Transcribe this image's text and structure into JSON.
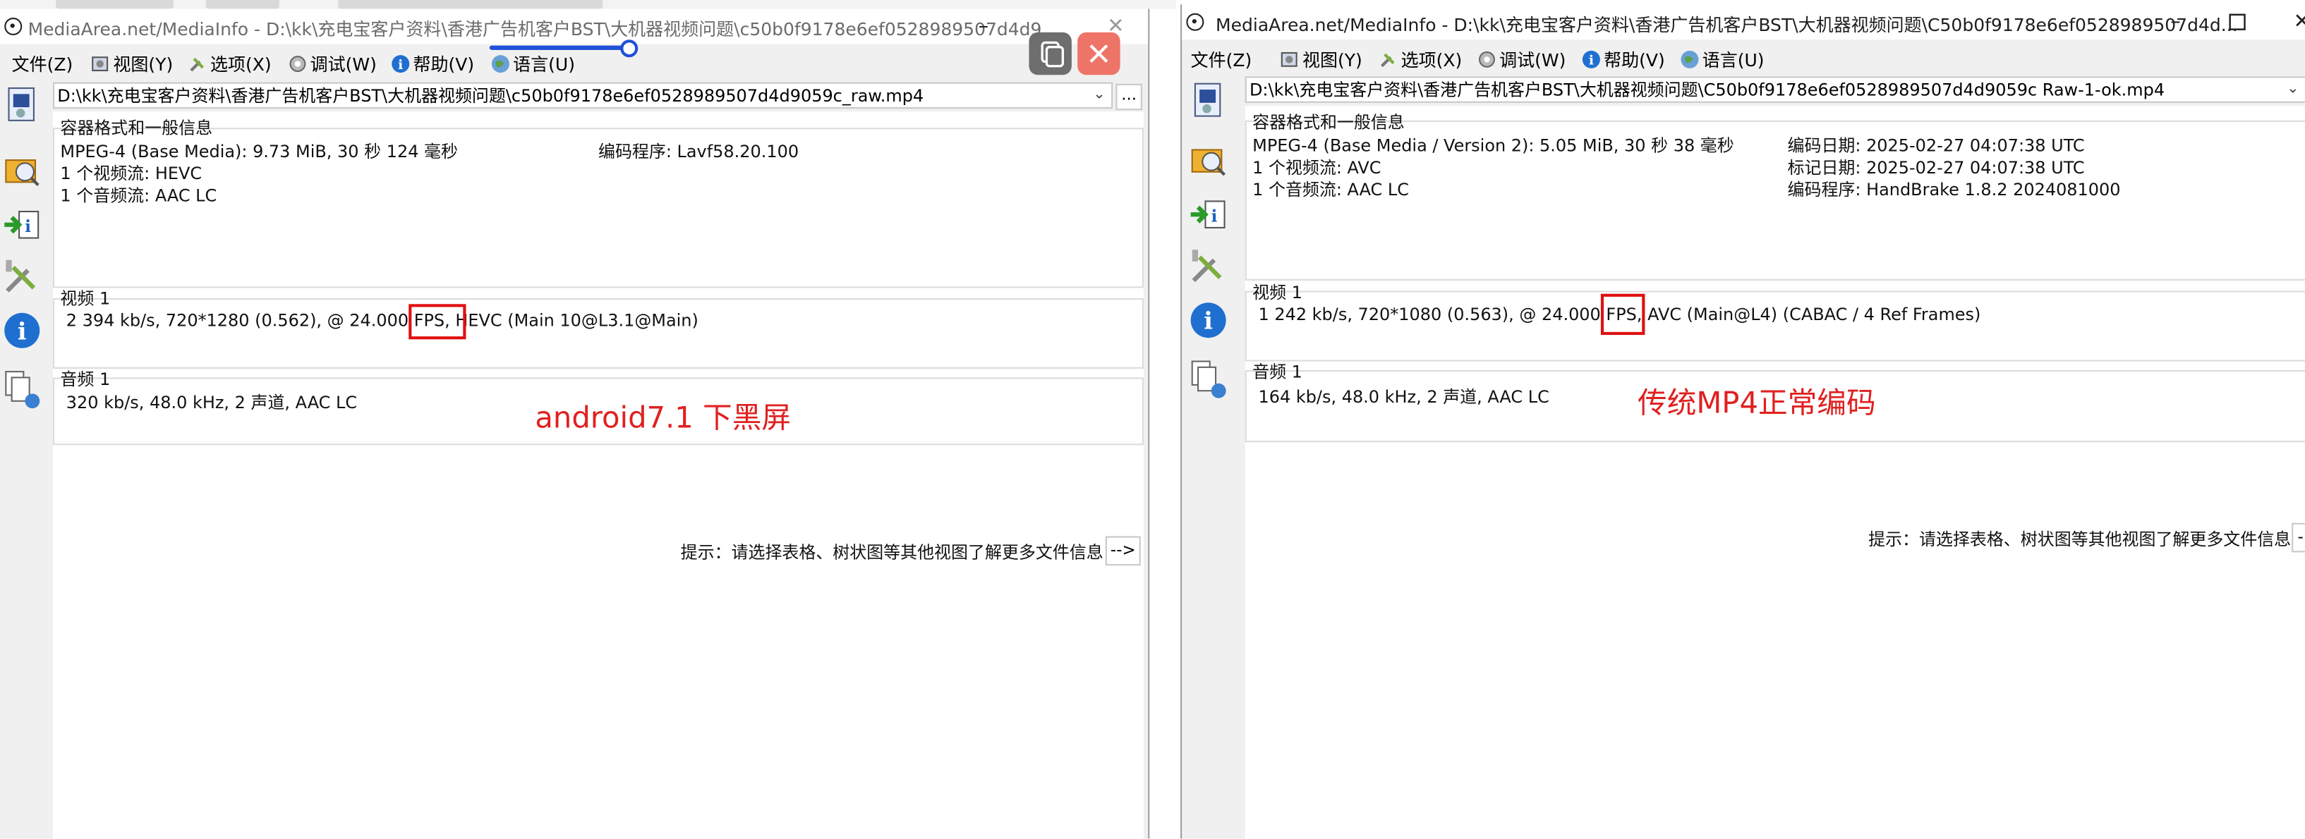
{
  "left": {
    "title": "MediaArea.net/MediaInfo - D:\\kk\\充电宝客户资料\\香港广告机客户BST\\大机器视频问题\\c50b0f9178e6ef0528989507d4d9...",
    "menu": [
      "文件(Z)",
      "视图(Y)",
      "选项(X)",
      "调试(W)",
      "帮助(V)",
      "语言(U)"
    ],
    "path": "D:\\kk\\充电宝客户资料\\香港广告机客户BST\\大机器视频问题\\c50b0f9178e6ef0528989507d4d9059c_raw.mp4",
    "dots": "...",
    "general_label": "容器格式和一般信息",
    "general_lines": [
      "MPEG-4 (Base Media): 9.73 MiB, 30 秒 124 毫秒",
      "1 个视频流: HEVC",
      "1 个音频流: AAC LC"
    ],
    "general_right": [
      "编码程序: Lavf58.20.100"
    ],
    "video_label": "视频 1",
    "video_line": "2 394 kb/s, 720*1280 (0.562), @ 24.000 FPS, HEVC (Main 10@L3.1@Main)",
    "audio_label": "音频 1",
    "audio_line": "320 kb/s, 48.0 kHz, 2 声道, AAC LC",
    "annotation": "android7.1 下黑屏",
    "hint": "提示：请选择表格、树状图等其他视图了解更多文件信息",
    "arrow": "-->"
  },
  "right": {
    "title": "MediaArea.net/MediaInfo - D:\\kk\\充电宝客户资料\\香港广告机客户BST\\大机器视频问题\\C50b0f9178e6ef0528989507d4d...",
    "menu": [
      "文件(Z)",
      "视图(Y)",
      "选项(X)",
      "调试(W)",
      "帮助(V)",
      "语言(U)"
    ],
    "path": "D:\\kk\\充电宝客户资料\\香港广告机客户BST\\大机器视频问题\\C50b0f9178e6ef0528989507d4d9059c Raw-1-ok.mp4",
    "general_label": "容器格式和一般信息",
    "general_lines": [
      "MPEG-4 (Base Media / Version 2): 5.05 MiB, 30 秒 38 毫秒",
      "1 个视频流: AVC",
      "1 个音频流: AAC LC"
    ],
    "general_right": [
      "编码日期: 2025-02-27 04:07:38 UTC",
      "标记日期: 2025-02-27 04:07:38 UTC",
      "编码程序: HandBrake 1.8.2 2024081000"
    ],
    "video_label": "视频 1",
    "video_line": "1 242 kb/s, 720*1080 (0.563), @ 24.000 FPS, AVC (Main@L4) (CABAC / 4 Ref Frames)",
    "audio_label": "音频 1",
    "audio_line": "164 kb/s, 48.0 kHz, 2 声道, AAC LC",
    "annotation": "传统MP4正常编码",
    "hint": "提示：请选择表格、树状图等其他视图了解更多文件信息",
    "arrow": "-"
  },
  "icons": {
    "menu": [
      "file-icon",
      "view-icon",
      "options-icon",
      "debug-icon",
      "help-icon",
      "language-icon"
    ],
    "toolbar": [
      "open-file-icon",
      "open-folder-icon",
      "export-icon",
      "options-tool-icon",
      "about-icon",
      "tree-view-icon"
    ]
  },
  "colors": {
    "annotation_red": "#e02020",
    "highlight_box": "#e01010",
    "accent_blue": "#2050d8"
  }
}
